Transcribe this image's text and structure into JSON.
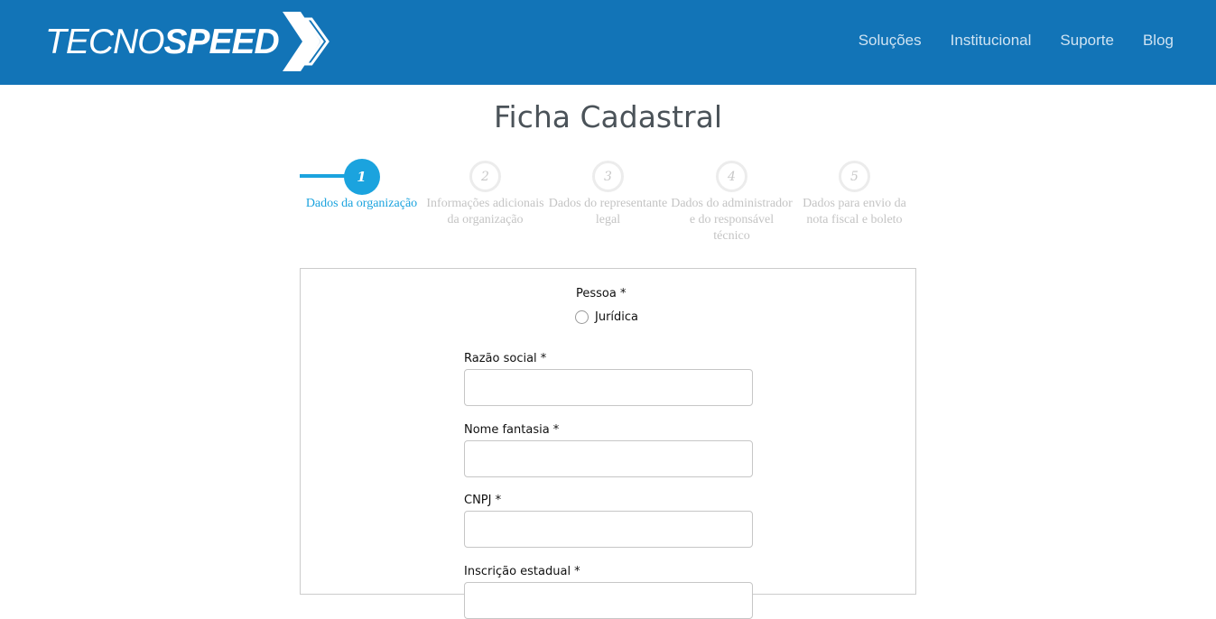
{
  "header": {
    "logo": {
      "part1": "TECNO",
      "part2": "SPEED"
    },
    "nav": [
      "Soluções",
      "Institucional",
      "Suporte",
      "Blog"
    ]
  },
  "page_title": "Ficha Cadastral",
  "stepper": {
    "current_step": 1,
    "steps": [
      {
        "number": "1",
        "label": "Dados da organização"
      },
      {
        "number": "2",
        "label": "Informações adicionais da organização"
      },
      {
        "number": "3",
        "label": "Dados do representante legal"
      },
      {
        "number": "4",
        "label": "Dados do administrador e do responsável técnico"
      },
      {
        "number": "5",
        "label": "Dados para envio da nota fiscal e boleto"
      }
    ]
  },
  "form": {
    "pessoa": {
      "label": "Pessoa *",
      "options": [
        {
          "label": "Jurídica",
          "selected": false
        }
      ]
    },
    "fields": [
      {
        "label": "Razão social *",
        "value": ""
      },
      {
        "label": "Nome fantasia *",
        "value": ""
      },
      {
        "label": "CNPJ *",
        "value": ""
      },
      {
        "label": "Inscrição estadual *",
        "value": ""
      }
    ]
  },
  "colors": {
    "header_bg": "#1274b7",
    "accent": "#1ba3de",
    "inactive_step": "#c4c4c4"
  }
}
